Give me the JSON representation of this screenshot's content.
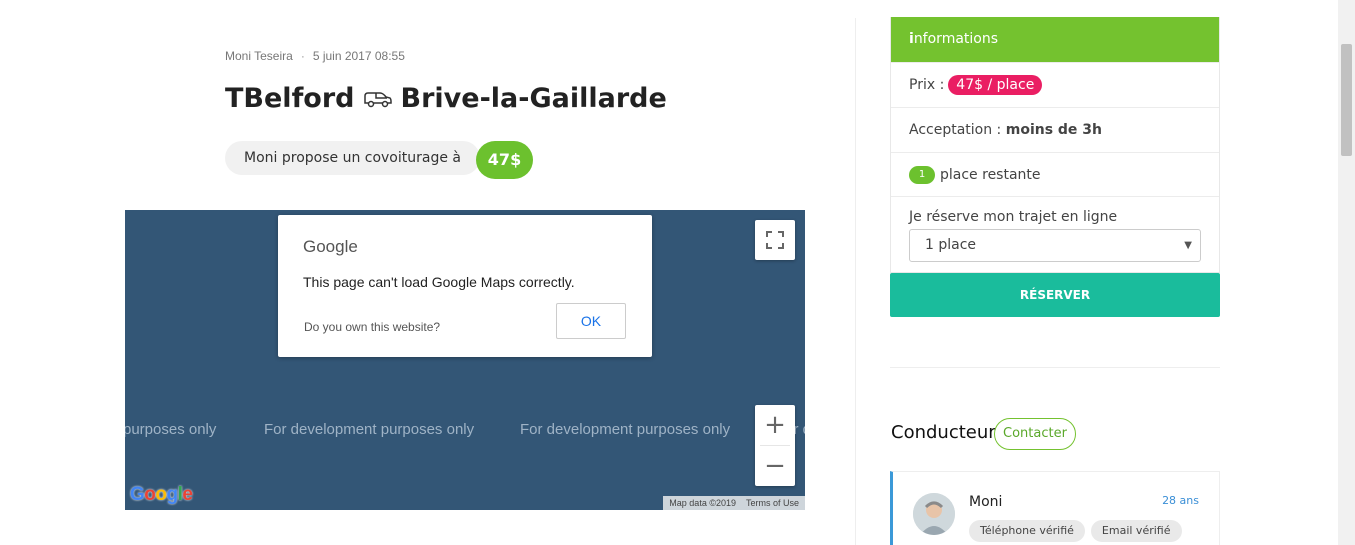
{
  "post": {
    "author": "Moni Teseira",
    "separator": "·",
    "date": "5 juin 2017 08:55",
    "from": "TBelford",
    "to": "Brive-la-Gaillarde",
    "offer_text": "Moni propose un covoiturage à",
    "price": "47$"
  },
  "map": {
    "dialog_logo": "Google",
    "dialog_message": "This page can't load Google Maps correctly.",
    "dialog_question": "Do you own this website?",
    "ok_label": "OK",
    "watermark": "For development purposes only",
    "watermark_partial": "purposes only",
    "watermark_partial_right": "For d",
    "zoom_in": "+",
    "zoom_out": "−",
    "logo": "Google",
    "map_data": "Map data ©2019",
    "terms": "Terms of Use"
  },
  "info": {
    "header_icon": "i",
    "header": "nformations",
    "price_label": "Prix :",
    "price_value": "47$ / place",
    "acceptance_label": "Acceptation :",
    "acceptance_value": "moins de 3h",
    "seats_count": "1",
    "seats_label": "place restante",
    "book_label": "Je réserve mon trajet en ligne",
    "select_value": "1 place",
    "reserve_button": "RÉSERVER"
  },
  "driver": {
    "section_title": "Conducteur",
    "contact_button": "Contacter",
    "name": "Moni",
    "age": "28 ans",
    "tags": [
      "Téléphone vérifié",
      "Email vérifié"
    ]
  },
  "colors": {
    "green": "#74c22f",
    "pink": "#ea1e63",
    "teal": "#1abc9c",
    "map_bg": "#335676"
  }
}
